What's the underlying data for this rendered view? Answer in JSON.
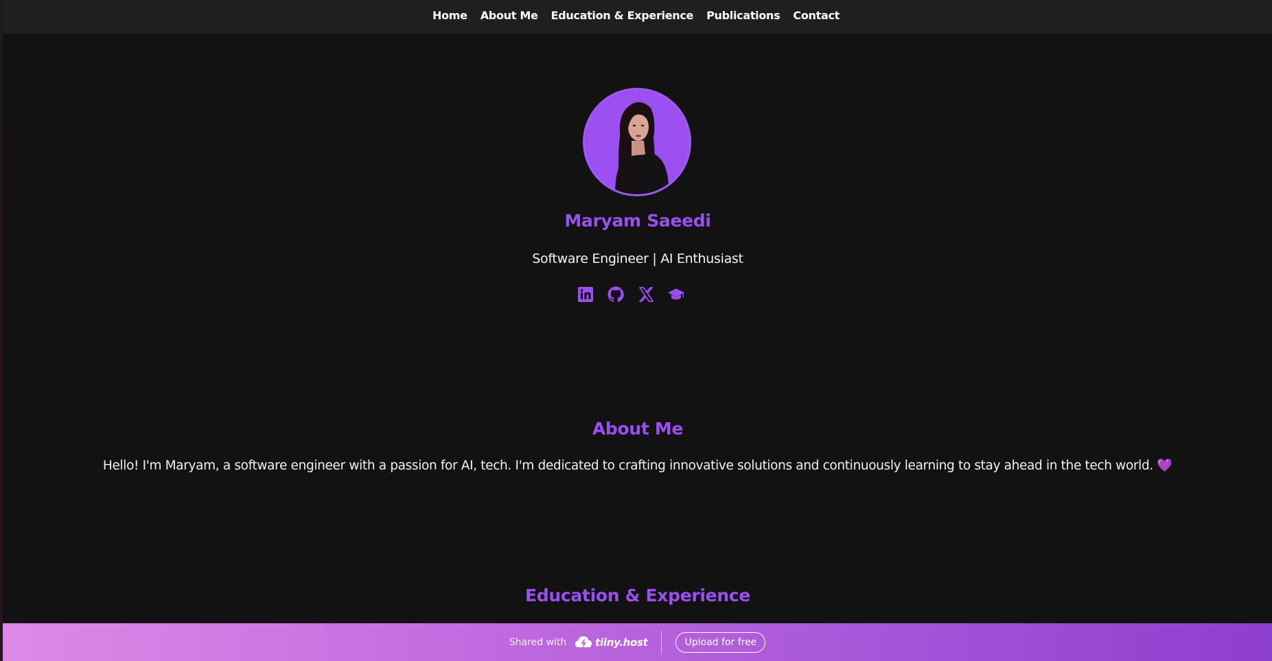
{
  "nav": {
    "items": [
      "Home",
      "About Me",
      "Education & Experience",
      "Publications",
      "Contact"
    ]
  },
  "profile": {
    "name": "Maryam Saeedi",
    "tagline": "Software Engineer | AI Enthusiast",
    "avatar_icon": "profile-photo",
    "socials": [
      "linkedin-icon",
      "github-icon",
      "x-icon",
      "graduation-cap-icon"
    ]
  },
  "about": {
    "title": "About Me",
    "text": "Hello! I'm Maryam, a software engineer with a passion for AI, tech. I'm dedicated to crafting innovative solutions and continuously learning to stay ahead in the tech world.",
    "emoji": "💜"
  },
  "education": {
    "title": "Education & Experience"
  },
  "banner": {
    "shared_label": "Shared with",
    "brand": "tiiny.host",
    "upload_label": "Upload for free"
  },
  "colors": {
    "accent": "#9b4ff0",
    "background": "#121213",
    "nav_bg": "#1f1f20",
    "banner_start": "#dc8ae6",
    "banner_end": "#8c3fd0"
  }
}
